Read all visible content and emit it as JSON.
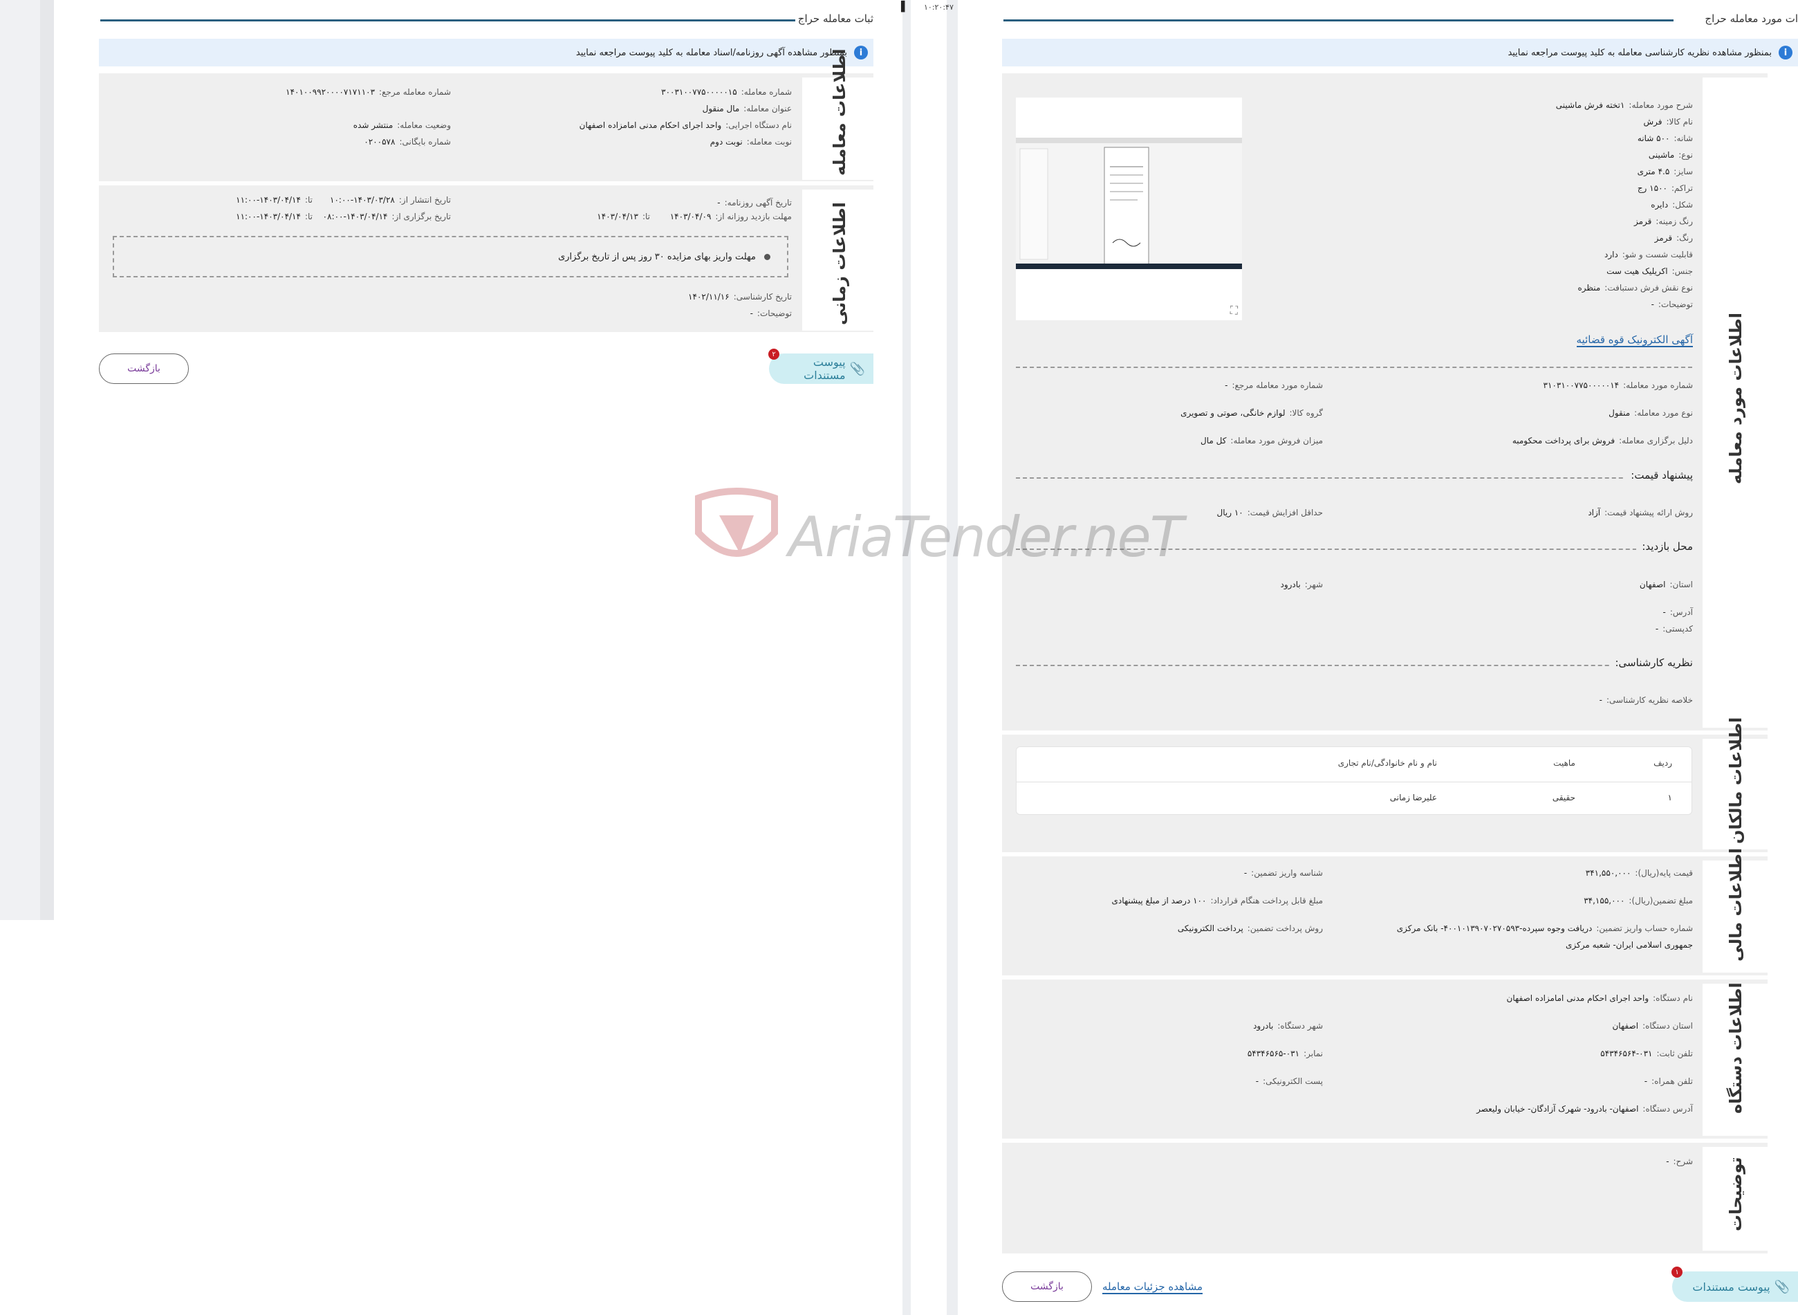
{
  "status_time": "۱۰:۲۰:۴۷",
  "watermark": {
    "text": "AriaTender.neT"
  },
  "left": {
    "title": "ثبات معامله حراج",
    "info": "بمنظور مشاهده آگهی روزنامه/اسناد معامله به کلید پیوست مراجعه نمایید",
    "deal_tab": "اطلاعات معامله",
    "deal": {
      "number_label": "شماره معامله:",
      "number": "۳۰۰۳۱۰۰۷۷۵۰۰۰۰۰۱۵",
      "ref_label": "شماره معامله مرجع:",
      "ref": "۱۴۰۱۰۰۹۹۲۰۰۰۰۷۱۷۱۱۰۳",
      "title_label": "عنوان معامله:",
      "title": "مال منقول",
      "org_label": "نام دستگاه اجرایی:",
      "org": "واحد اجرای احکام مدنی امامزاده اصفهان",
      "status_label": "وضعیت معامله:",
      "status": "منتشر شده",
      "turn_label": "نوبت معامله:",
      "turn": "نوبت دوم",
      "archive_label": "شماره بایگانی:",
      "archive": "۰۲۰۰۵۷۸"
    },
    "time_tab": "اطلاعات زمانی",
    "time": {
      "ad_label": "تاریخ آگهی روزنامه:",
      "ad": "-",
      "publish_label": "تاریخ انتشار از:",
      "publish_from": "۱۴۰۳/۰۳/۲۸-۱۰:۰۰",
      "to_label": "تا:",
      "publish_to": "۱۴۰۳/۰۴/۱۴-۱۱:۰۰",
      "visit_label": "مهلت بازدید روزانه از:",
      "visit_from": "۱۴۰۳/۰۴/۰۹",
      "visit_to": "۱۴۰۳/۰۴/۱۳",
      "hold_label": "تاریخ برگزاری از:",
      "hold_from": "۱۴۰۳/۰۴/۱۴-۰۸:۰۰",
      "hold_to": "۱۴۰۳/۰۴/۱۴-۱۱:۰۰",
      "note": "مهلت واریز بهای مزایده ۳۰ روز پس از تاریخ برگزاری",
      "expert_label": "تاریخ کارشناسی:",
      "expert": "۱۴۰۲/۱۱/۱۶",
      "desc_label": "توضیحات:",
      "desc": "-"
    },
    "attach_label": "پیوست مستندات",
    "attach_badge": "۲",
    "back_label": "بازگشت"
  },
  "right": {
    "title": "ات مورد معامله حراج",
    "info": "بمنظور مشاهده نظریه کارشناسی معامله به کلید پیوست مراجعه نمایید",
    "item_tab": "اطلاعات مورد معامله",
    "item": {
      "desc_label": "شرح مورد معامله:",
      "desc": "۱تخته فرش ماشینی",
      "name_label": "نام کالا:",
      "name": "فرش",
      "shaneh_label": "شانه:",
      "shaneh": "۵۰۰ شانه",
      "type_label": "نوع:",
      "type": "ماشینی",
      "size_label": "سایز:",
      "size": "۴.۵ متری",
      "density_label": "تراکم:",
      "density": "۱۵۰۰ رج",
      "shape_label": "شکل:",
      "shape": "دایره",
      "bg_label": "رنگ زمینه:",
      "bg": "قرمز",
      "color_label": "رنگ:",
      "color": "قرمز",
      "wash_label": "قابلیت شست و شو:",
      "wash": "دارد",
      "material_label": "جنس:",
      "material": "اکریلیک هیت ست",
      "pattern_label": "نوع نقش فرش دستبافت:",
      "pattern": "منظره",
      "notes_label": "توضیحات:",
      "notes": "-",
      "eauction_link": "آگهی الکترونیک قوه قضائیه",
      "itemno_label": "شماره مورد معامله:",
      "itemno": "۳۱۰۳۱۰۰۷۷۵۰۰۰۰۰۱۴",
      "refitem_label": "شماره مورد معامله مرجع:",
      "refitem": "-",
      "kind_label": "نوع مورد معامله:",
      "kind": "منقول",
      "group_label": "گروه کالا:",
      "group": "لوازم خانگی، صوتی و تصویری",
      "reason_label": "دلیل برگزاری معامله:",
      "reason": "فروش برای پرداخت محکومبه",
      "amount_label": "میزان فروش مورد معامله:",
      "amount": "کل مال",
      "offer_head": "پیشنهاد قیمت:",
      "method_label": "روش ارائه پیشنهاد قیمت:",
      "method": "آزاد",
      "minraise_label": "حداقل افزایش قیمت:",
      "minraise": "۱۰ ریال",
      "visit_head": "محل بازدید:",
      "province_label": "استان:",
      "province": "اصفهان",
      "city_label": "شهر:",
      "city": "بادرود",
      "address_label": "آدرس:",
      "address": "-",
      "postal_label": "کدپستی:",
      "postal": "-",
      "expert_head": "نظریه کارشناسی:",
      "expert_label": "خلاصه نظریه کارشناسی:",
      "expert": "-"
    },
    "owners_tab": "اطلاعات مالکان",
    "owners": {
      "headers": [
        "ردیف",
        "ماهیت",
        "نام و نام خانوادگی/نام تجاری"
      ],
      "rows": [
        [
          "۱",
          "حقیقی",
          "علیرضا زمانی"
        ]
      ]
    },
    "finance_tab": "اطلاعات مالی",
    "finance": {
      "base_label": "قیمت پایه(ریال):",
      "base": "۳۴۱,۵۵۰,۰۰۰",
      "deposit_id_label": "شناسه واریز تضمین:",
      "deposit_id": "-",
      "guarantee_label": "مبلغ تضمین(ریال):",
      "guarantee": "۳۴,۱۵۵,۰۰۰",
      "payable_label": "مبلغ قابل پرداخت هنگام قرارداد:",
      "payable": "۱۰۰ درصد از مبلغ پیشنهادی",
      "account_label": "شماره حساب واریز تضمین:",
      "account": "دریافت وجوه سپرده-۴۰۰۱۰۱۳۹۰۷۰۲۷۰۵۹۳- بانک مرکزی",
      "account2": "جمهوری اسلامی ایران- شعبه مرکزی",
      "paymethod_label": "روش پرداخت تضمین:",
      "paymethod": "پرداخت الکترونیکی"
    },
    "org_tab": "اطلاعات دستگاه",
    "org": {
      "name_label": "نام دستگاه:",
      "name": "واحد اجرای احکام مدنی امامزاده اصفهان",
      "prov_label": "استان دستگاه:",
      "prov": "اصفهان",
      "city_label": "شهر دستگاه:",
      "city": "بادرود",
      "phone_label": "تلفن ثابت:",
      "phone": "۰۳۱-۵۴۳۴۶۵۶۴",
      "fax_label": "نمابر:",
      "fax": "۰۳۱-۵۴۳۴۶۵۶۵",
      "mobile_label": "تلفن همراه:",
      "mobile": "-",
      "email_label": "پست الکترونیکی:",
      "email": "-",
      "addr_label": "آدرس دستگاه:",
      "addr": "اصفهان- بادرود- شهرک آزادگان- خیابان ولیعصر"
    },
    "desc_tab": "توضیحات",
    "desc": {
      "label": "شرح:",
      "value": "-"
    },
    "attach_label": "پیوست مستندات",
    "attach_badge": "۱",
    "details_link": "مشاهده جزئیات معامله",
    "back_label": "بازگشت"
  }
}
